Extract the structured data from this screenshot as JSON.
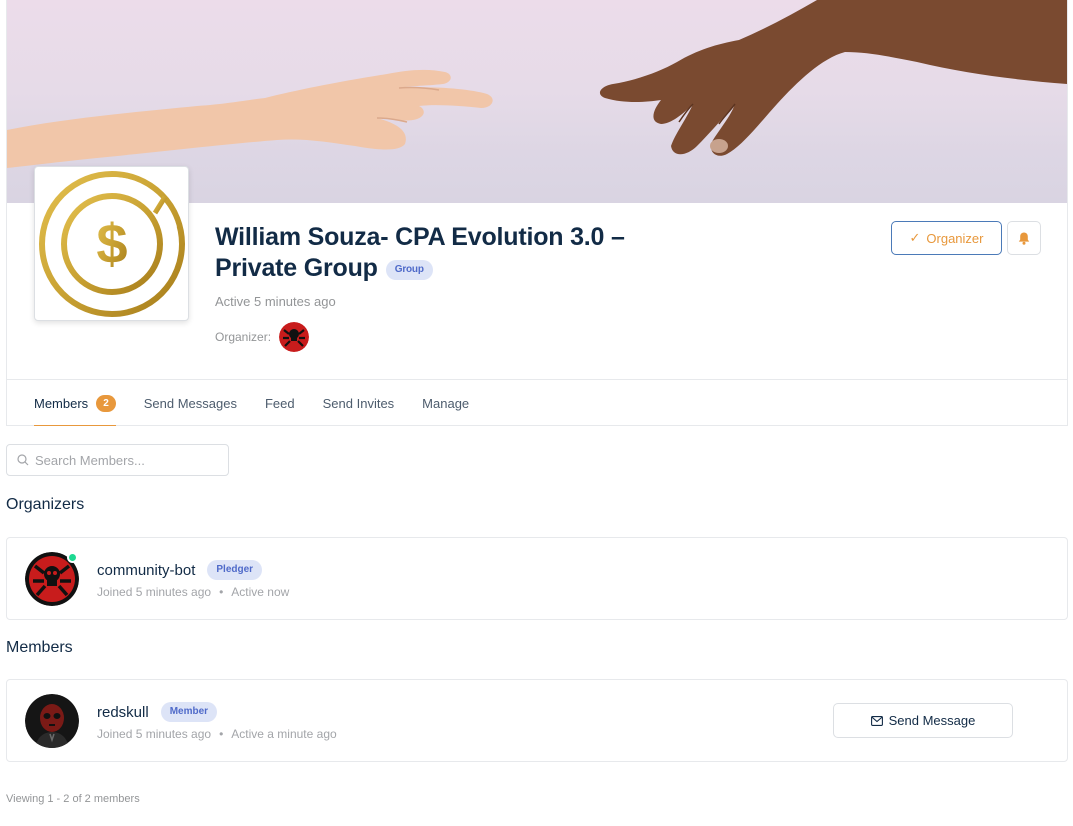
{
  "group": {
    "title": "William Souza- CPA Evolution 3.0 – Private Group",
    "type_badge": "Group",
    "active": "Active 5 minutes ago",
    "organizer_label": "Organizer:",
    "organizer_button": "Organizer",
    "avatar_icon": "dollar-coin-icon"
  },
  "tabs": [
    {
      "label": "Members",
      "count": "2"
    },
    {
      "label": "Send Messages"
    },
    {
      "label": "Feed"
    },
    {
      "label": "Send Invites"
    },
    {
      "label": "Manage"
    }
  ],
  "search": {
    "placeholder": "Search Members..."
  },
  "organizers": {
    "title": "Organizers",
    "items": [
      {
        "name": "community-bot",
        "badge": "Pledger",
        "joined": "Joined 5 minutes ago",
        "separator": "•",
        "active": "Active now",
        "online": true
      }
    ]
  },
  "members": {
    "title": "Members",
    "items": [
      {
        "name": "redskull",
        "badge": "Member",
        "joined": "Joined 5 minutes ago",
        "separator": "•",
        "active": "Active a minute ago",
        "action": "Send Message"
      }
    ]
  },
  "pagination": {
    "text": "Viewing 1 - 2 of 2 members"
  },
  "colors": {
    "accent": "#e8983c",
    "primary": "#4b7ab8",
    "badge_bg": "#dde4f7",
    "badge_text": "#4f6ac9",
    "online": "#1cd991"
  }
}
